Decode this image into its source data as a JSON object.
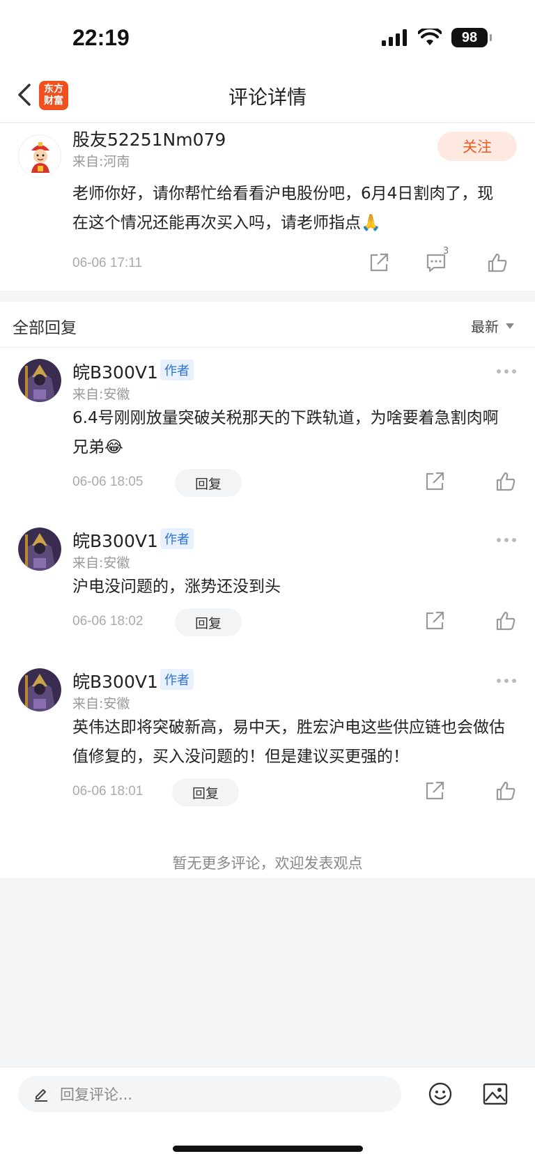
{
  "status_bar": {
    "time": "22:19",
    "battery": "98"
  },
  "nav": {
    "title": "评论详情",
    "logo_line1": "东方",
    "logo_line2": "财富"
  },
  "main_post": {
    "username": "股友52251Nm079",
    "location": "来自:河南",
    "follow_label": "关注",
    "content": "老师你好，请你帮忙给看看沪电股份吧，6月4日割肉了，现在这个情况还能再次买入吗，请老师指点🙏",
    "timestamp": "06-06 17:11",
    "comment_count": "3"
  },
  "replies_header": {
    "title": "全部回复",
    "sort_label": "最新"
  },
  "replies": [
    {
      "username": "皖B300V1",
      "badge": "作者",
      "location": "来自:安徽",
      "content": "6.4号刚刚放量突破关税那天的下跌轨道，为啥要着急割肉啊兄弟😂",
      "timestamp": "06-06 18:05",
      "reply_label": "回复"
    },
    {
      "username": "皖B300V1",
      "badge": "作者",
      "location": "来自:安徽",
      "content": "沪电没问题的，涨势还没到头",
      "timestamp": "06-06 18:02",
      "reply_label": "回复"
    },
    {
      "username": "皖B300V1",
      "badge": "作者",
      "location": "来自:安徽",
      "content": "英伟达即将突破新高，易中天，胜宏沪电这些供应链也会做估值修复的，买入没问题的！但是建议买更强的！",
      "timestamp": "06-06 18:01",
      "reply_label": "回复"
    }
  ],
  "footer_note": "暂无更多评论，欢迎发表观点",
  "input_bar": {
    "placeholder": "回复评论..."
  },
  "colors": {
    "accent": "#f05a24",
    "badge_bg": "#e8f1fd",
    "badge_text": "#2a72d9",
    "logo_bg": "#f0501e"
  }
}
